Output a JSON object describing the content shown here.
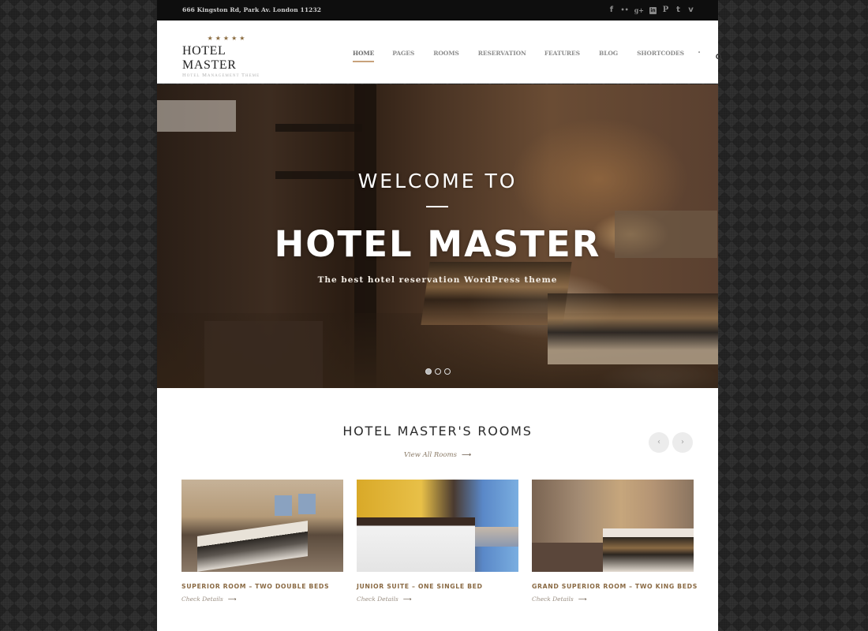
{
  "topbar": {
    "address": "666 Kingston Rd, Park Av. London 11232",
    "social": [
      {
        "icon": "facebook-icon",
        "glyph": "f"
      },
      {
        "icon": "flickr-icon",
        "glyph": "••"
      },
      {
        "icon": "google-plus-icon",
        "glyph": "g+"
      },
      {
        "icon": "linkedin-icon",
        "glyph": "in"
      },
      {
        "icon": "pinterest-icon",
        "glyph": "P"
      },
      {
        "icon": "twitter-icon",
        "glyph": "t"
      },
      {
        "icon": "vimeo-icon",
        "glyph": "v"
      }
    ]
  },
  "header": {
    "logo": {
      "stars": "★★★★★",
      "name": "HOTEL MASTER",
      "tagline": "Hotel Management Theme"
    },
    "nav": [
      {
        "label": "HOME",
        "active": true
      },
      {
        "label": "PAGES"
      },
      {
        "label": "ROOMS"
      },
      {
        "label": "RESERVATION"
      },
      {
        "label": "FEATURES"
      },
      {
        "label": "BLOG"
      },
      {
        "label": "SHORTCODES"
      }
    ],
    "nav_dot": "•",
    "search_icon": "search-icon"
  },
  "hero": {
    "kicker": "WELCOME TO",
    "title": "HOTEL MASTER",
    "subtitle": "The best hotel reservation WordPress theme",
    "slides": 3,
    "active_slide": 1
  },
  "rooms_section": {
    "title": "HOTEL MASTER'S ROOMS",
    "view_all": "View All Rooms",
    "arrow": "⟶",
    "prev": "‹",
    "next": "›",
    "rooms": [
      {
        "name": "SUPERIOR ROOM – TWO DOUBLE BEDS",
        "link": "Check Details"
      },
      {
        "name": "JUNIOR SUITE – ONE SINGLE BED",
        "link": "Check Details"
      },
      {
        "name": "GRAND SUPERIOR ROOM – TWO KING BEDS",
        "link": "Check Details"
      }
    ]
  },
  "colors": {
    "accent": "#c8a27c",
    "room_title": "#8a6a44",
    "topbar_bg": "#0e0e0e"
  }
}
